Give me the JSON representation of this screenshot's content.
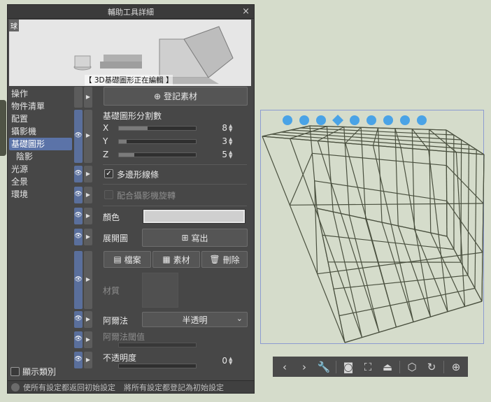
{
  "window": {
    "title": "輔助工具詳細",
    "close_label": "×"
  },
  "preview": {
    "tag": "球",
    "caption": "【 3D基礎圖形正在編輯 】"
  },
  "nav": {
    "items": [
      {
        "label": "操作"
      },
      {
        "label": "物件清單"
      },
      {
        "label": "配置"
      },
      {
        "label": "攝影機"
      },
      {
        "label": "基礎圖形"
      },
      {
        "label": "陰影"
      },
      {
        "label": "光源"
      },
      {
        "label": "全景"
      },
      {
        "label": "環境"
      }
    ],
    "active_index": 4
  },
  "register_material_label": "登記素材",
  "division": {
    "title": "基礎圖形分割數",
    "x": {
      "label": "X",
      "value": "8",
      "fraction": 0.27
    },
    "y": {
      "label": "Y",
      "value": "3",
      "fraction": 0.08
    },
    "z": {
      "label": "Z",
      "value": "5",
      "fraction": 0.15
    }
  },
  "polygon_lines": {
    "label": "多邊形線條",
    "checked": true
  },
  "camera_rotate": {
    "label": "配合攝影機旋轉",
    "checked": false
  },
  "color_label": "顏色",
  "color_value": "#cfcfcf",
  "unfold": {
    "label": "展開圖",
    "export_label": "寫出"
  },
  "file_buttons": {
    "file": "檔案",
    "material": "素材",
    "delete": "刪除"
  },
  "texture_label": "材質",
  "alpha": {
    "label": "阿爾法",
    "value": "半透明",
    "threshold_label": "阿爾法閾值"
  },
  "opacity": {
    "label": "不透明度",
    "value": "0"
  },
  "show_category": {
    "label": "顯示類別",
    "checked": false
  },
  "footer": {
    "reset_label": "使所有設定都返回初始設定",
    "register_label": "將所有設定都登記為初始設定"
  },
  "colors": {
    "accent": "#5b73a8",
    "panel": "#474747",
    "canvas": "#d5dccb",
    "wire": "#4a503f",
    "selection": "#8c9bd1"
  },
  "toolbar_icons": [
    "chevron-left-icon",
    "chevron-right-icon",
    "wrench-icon",
    "camera-reset-icon",
    "fit-view-icon",
    "ground-icon",
    "object-add-icon",
    "object-rotate-icon",
    "add-layer-icon"
  ]
}
